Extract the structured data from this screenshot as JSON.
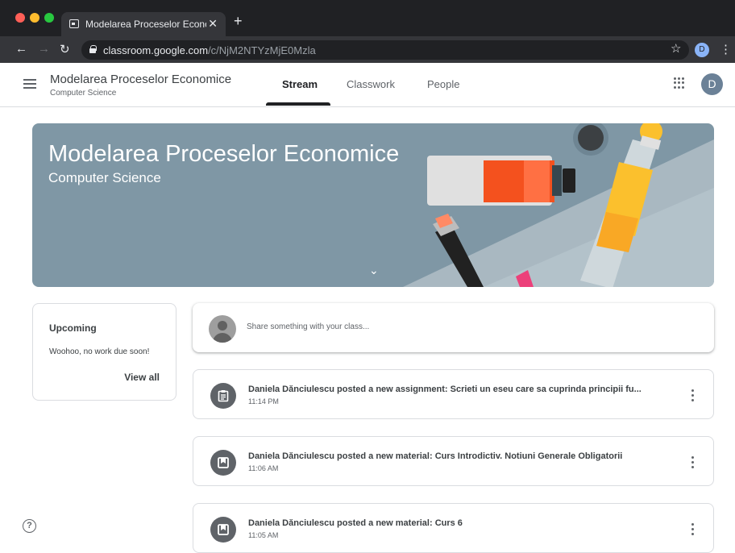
{
  "browser": {
    "tab_title": "Modelarea Proceselor Economic",
    "tab_close": "✕",
    "new_tab": "+",
    "url_host": "classroom.google.com",
    "url_path": "/c/NjM2NTYzMjE0Mzla",
    "profile_initial": "D"
  },
  "header": {
    "course_title": "Modelarea Proceselor Economice",
    "course_subtitle": "Computer Science",
    "tabs": [
      {
        "label": "Stream"
      },
      {
        "label": "Classwork"
      },
      {
        "label": "People"
      }
    ],
    "active_tab": "Stream",
    "account_initial": "D"
  },
  "banner": {
    "title": "Modelarea Proceselor Economice",
    "subtitle": "Computer Science",
    "chevron": "⌄"
  },
  "upcoming": {
    "title": "Upcoming",
    "message": "Woohoo, no work due soon!",
    "link": "View all"
  },
  "share": {
    "placeholder": "Share something with your class..."
  },
  "posts": [
    {
      "icon": "assignment-icon",
      "title": "Daniela Dănciulescu posted a new assignment: Scrieti un eseu care sa cuprinda principii fu...",
      "time": "11:14 PM"
    },
    {
      "icon": "material-icon",
      "title": "Daniela Dănciulescu posted a new material: Curs Introdictiv. Notiuni Generale Obligatorii",
      "time": "11:06 AM"
    },
    {
      "icon": "material-icon",
      "title": "Daniela Dănciulescu posted a new material: Curs 6",
      "time": "11:05 AM"
    }
  ],
  "colors": {
    "banner": "#7f97a5",
    "chrome_dark": "#202124",
    "accent": "#202124"
  }
}
